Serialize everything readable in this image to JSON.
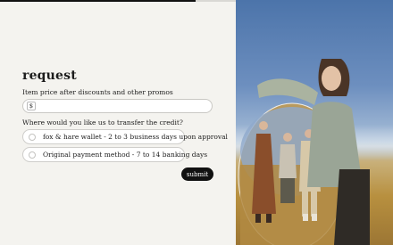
{
  "progress": {
    "fraction": 0.83
  },
  "form": {
    "title": "request",
    "price_label": "Item price after discounts and other promos",
    "currency_symbol": "$",
    "price_value": "",
    "transfer_question": "Where would you like us to transfer the credit?",
    "options": [
      {
        "label": "fox & hare wallet - 2 to 3 business days upon approval",
        "selected": false
      },
      {
        "label": "Original payment method - 7 to 14 banking days",
        "selected": false
      }
    ],
    "submit_label": "submit"
  },
  "hero_image": {
    "subject": "fashion photo: woman holding an oval mirror reflecting three models in a wheat field"
  },
  "colors": {
    "background": "#f4f3ef",
    "accent": "#111111",
    "field_border": "#c9c8c4"
  }
}
